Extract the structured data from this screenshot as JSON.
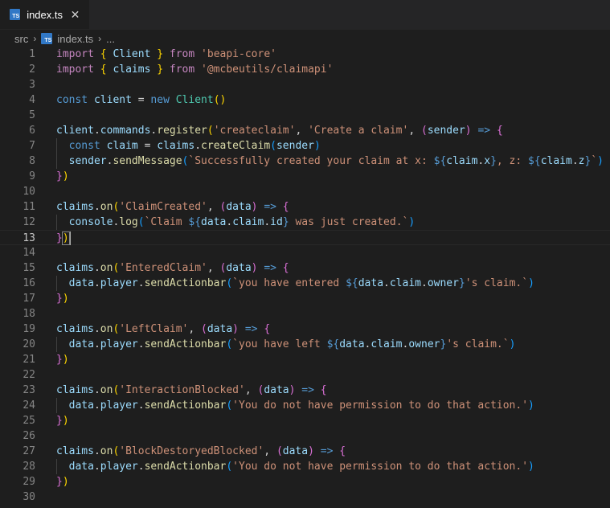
{
  "tab": {
    "icon_label": "TS",
    "title": "index.ts",
    "close_glyph": "✕"
  },
  "breadcrumb": {
    "folder": "src",
    "sep1": "›",
    "file": "index.ts",
    "sep2": "›",
    "more": "..."
  },
  "editor": {
    "current_line": 13,
    "lines": [
      {
        "n": "1",
        "tokens": [
          [
            "kwc",
            "import"
          ],
          [
            "p",
            " "
          ],
          [
            "b1",
            "{"
          ],
          [
            "p",
            " "
          ],
          [
            "var",
            "Client"
          ],
          [
            "p",
            " "
          ],
          [
            "b1",
            "}"
          ],
          [
            "p",
            " "
          ],
          [
            "kwc",
            "from"
          ],
          [
            "p",
            " "
          ],
          [
            "str",
            "'beapi-core'"
          ]
        ]
      },
      {
        "n": "2",
        "tokens": [
          [
            "kwc",
            "import"
          ],
          [
            "p",
            " "
          ],
          [
            "b1",
            "{"
          ],
          [
            "p",
            " "
          ],
          [
            "var",
            "claims"
          ],
          [
            "p",
            " "
          ],
          [
            "b1",
            "}"
          ],
          [
            "p",
            " "
          ],
          [
            "kwc",
            "from"
          ],
          [
            "p",
            " "
          ],
          [
            "str",
            "'@mcbeutils/claimapi'"
          ]
        ]
      },
      {
        "n": "3",
        "tokens": []
      },
      {
        "n": "4",
        "tokens": [
          [
            "kw",
            "const"
          ],
          [
            "p",
            " "
          ],
          [
            "var",
            "client"
          ],
          [
            "p",
            " = "
          ],
          [
            "kw",
            "new"
          ],
          [
            "p",
            " "
          ],
          [
            "cls",
            "Client"
          ],
          [
            "b1",
            "()"
          ]
        ]
      },
      {
        "n": "5",
        "tokens": []
      },
      {
        "n": "6",
        "tokens": [
          [
            "var",
            "client"
          ],
          [
            "p",
            "."
          ],
          [
            "var",
            "commands"
          ],
          [
            "p",
            "."
          ],
          [
            "fn",
            "register"
          ],
          [
            "b1",
            "("
          ],
          [
            "str",
            "'createclaim'"
          ],
          [
            "p",
            ", "
          ],
          [
            "str",
            "'Create a claim'"
          ],
          [
            "p",
            ", "
          ],
          [
            "b2",
            "("
          ],
          [
            "var",
            "sender"
          ],
          [
            "b2",
            ")"
          ],
          [
            "p",
            " "
          ],
          [
            "kw",
            "=>"
          ],
          [
            "p",
            " "
          ],
          [
            "b2",
            "{"
          ]
        ]
      },
      {
        "n": "7",
        "indent": true,
        "tokens": [
          [
            "p",
            "  "
          ],
          [
            "kw",
            "const"
          ],
          [
            "p",
            " "
          ],
          [
            "var",
            "claim"
          ],
          [
            "p",
            " = "
          ],
          [
            "var",
            "claims"
          ],
          [
            "p",
            "."
          ],
          [
            "fn",
            "createClaim"
          ],
          [
            "b3",
            "("
          ],
          [
            "var",
            "sender"
          ],
          [
            "b3",
            ")"
          ]
        ]
      },
      {
        "n": "8",
        "indent": true,
        "tokens": [
          [
            "p",
            "  "
          ],
          [
            "var",
            "sender"
          ],
          [
            "p",
            "."
          ],
          [
            "fn",
            "sendMessage"
          ],
          [
            "b3",
            "("
          ],
          [
            "str",
            "`Successfully created your claim at x: "
          ],
          [
            "int",
            "${"
          ],
          [
            "var",
            "claim"
          ],
          [
            "p",
            "."
          ],
          [
            "var",
            "x"
          ],
          [
            "int",
            "}"
          ],
          [
            "str",
            ", z: "
          ],
          [
            "int",
            "${"
          ],
          [
            "var",
            "claim"
          ],
          [
            "p",
            "."
          ],
          [
            "var",
            "z"
          ],
          [
            "int",
            "}"
          ],
          [
            "str",
            "`"
          ],
          [
            "b3",
            ")"
          ]
        ]
      },
      {
        "n": "9",
        "tokens": [
          [
            "b2",
            "}"
          ],
          [
            "b1",
            ")"
          ]
        ]
      },
      {
        "n": "10",
        "tokens": []
      },
      {
        "n": "11",
        "tokens": [
          [
            "var",
            "claims"
          ],
          [
            "p",
            "."
          ],
          [
            "fn",
            "on"
          ],
          [
            "b1",
            "("
          ],
          [
            "str",
            "'ClaimCreated'"
          ],
          [
            "p",
            ", "
          ],
          [
            "b2",
            "("
          ],
          [
            "var",
            "data"
          ],
          [
            "b2",
            ")"
          ],
          [
            "p",
            " "
          ],
          [
            "kw",
            "=>"
          ],
          [
            "p",
            " "
          ],
          [
            "b2",
            "{"
          ]
        ]
      },
      {
        "n": "12",
        "indent": true,
        "tokens": [
          [
            "p",
            "  "
          ],
          [
            "var",
            "console"
          ],
          [
            "p",
            "."
          ],
          [
            "fn",
            "log"
          ],
          [
            "b3",
            "("
          ],
          [
            "str",
            "`Claim "
          ],
          [
            "int",
            "${"
          ],
          [
            "var",
            "data"
          ],
          [
            "p",
            "."
          ],
          [
            "var",
            "claim"
          ],
          [
            "p",
            "."
          ],
          [
            "var",
            "id"
          ],
          [
            "int",
            "}"
          ],
          [
            "str",
            " was just created.`"
          ],
          [
            "b3",
            ")"
          ]
        ]
      },
      {
        "n": "13",
        "tokens": [
          [
            "b2",
            "}"
          ],
          [
            "b1",
            ")"
          ]
        ]
      },
      {
        "n": "14",
        "tokens": []
      },
      {
        "n": "15",
        "tokens": [
          [
            "var",
            "claims"
          ],
          [
            "p",
            "."
          ],
          [
            "fn",
            "on"
          ],
          [
            "b1",
            "("
          ],
          [
            "str",
            "'EnteredClaim'"
          ],
          [
            "p",
            ", "
          ],
          [
            "b2",
            "("
          ],
          [
            "var",
            "data"
          ],
          [
            "b2",
            ")"
          ],
          [
            "p",
            " "
          ],
          [
            "kw",
            "=>"
          ],
          [
            "p",
            " "
          ],
          [
            "b2",
            "{"
          ]
        ]
      },
      {
        "n": "16",
        "indent": true,
        "tokens": [
          [
            "p",
            "  "
          ],
          [
            "var",
            "data"
          ],
          [
            "p",
            "."
          ],
          [
            "var",
            "player"
          ],
          [
            "p",
            "."
          ],
          [
            "fn",
            "sendActionbar"
          ],
          [
            "b3",
            "("
          ],
          [
            "str",
            "`you have entered "
          ],
          [
            "int",
            "${"
          ],
          [
            "var",
            "data"
          ],
          [
            "p",
            "."
          ],
          [
            "var",
            "claim"
          ],
          [
            "p",
            "."
          ],
          [
            "var",
            "owner"
          ],
          [
            "int",
            "}"
          ],
          [
            "str",
            "'s claim.`"
          ],
          [
            "b3",
            ")"
          ]
        ]
      },
      {
        "n": "17",
        "tokens": [
          [
            "b2",
            "}"
          ],
          [
            "b1",
            ")"
          ]
        ]
      },
      {
        "n": "18",
        "tokens": []
      },
      {
        "n": "19",
        "tokens": [
          [
            "var",
            "claims"
          ],
          [
            "p",
            "."
          ],
          [
            "fn",
            "on"
          ],
          [
            "b1",
            "("
          ],
          [
            "str",
            "'LeftClaim'"
          ],
          [
            "p",
            ", "
          ],
          [
            "b2",
            "("
          ],
          [
            "var",
            "data"
          ],
          [
            "b2",
            ")"
          ],
          [
            "p",
            " "
          ],
          [
            "kw",
            "=>"
          ],
          [
            "p",
            " "
          ],
          [
            "b2",
            "{"
          ]
        ]
      },
      {
        "n": "20",
        "indent": true,
        "tokens": [
          [
            "p",
            "  "
          ],
          [
            "var",
            "data"
          ],
          [
            "p",
            "."
          ],
          [
            "var",
            "player"
          ],
          [
            "p",
            "."
          ],
          [
            "fn",
            "sendActionbar"
          ],
          [
            "b3",
            "("
          ],
          [
            "str",
            "`you have left "
          ],
          [
            "int",
            "${"
          ],
          [
            "var",
            "data"
          ],
          [
            "p",
            "."
          ],
          [
            "var",
            "claim"
          ],
          [
            "p",
            "."
          ],
          [
            "var",
            "owner"
          ],
          [
            "int",
            "}"
          ],
          [
            "str",
            "'s claim.`"
          ],
          [
            "b3",
            ")"
          ]
        ]
      },
      {
        "n": "21",
        "tokens": [
          [
            "b2",
            "}"
          ],
          [
            "b1",
            ")"
          ]
        ]
      },
      {
        "n": "22",
        "tokens": []
      },
      {
        "n": "23",
        "tokens": [
          [
            "var",
            "claims"
          ],
          [
            "p",
            "."
          ],
          [
            "fn",
            "on"
          ],
          [
            "b1",
            "("
          ],
          [
            "str",
            "'InteractionBlocked'"
          ],
          [
            "p",
            ", "
          ],
          [
            "b2",
            "("
          ],
          [
            "var",
            "data"
          ],
          [
            "b2",
            ")"
          ],
          [
            "p",
            " "
          ],
          [
            "kw",
            "=>"
          ],
          [
            "p",
            " "
          ],
          [
            "b2",
            "{"
          ]
        ]
      },
      {
        "n": "24",
        "indent": true,
        "tokens": [
          [
            "p",
            "  "
          ],
          [
            "var",
            "data"
          ],
          [
            "p",
            "."
          ],
          [
            "var",
            "player"
          ],
          [
            "p",
            "."
          ],
          [
            "fn",
            "sendActionbar"
          ],
          [
            "b3",
            "("
          ],
          [
            "str",
            "'You do not have permission to do that action.'"
          ],
          [
            "b3",
            ")"
          ]
        ]
      },
      {
        "n": "25",
        "tokens": [
          [
            "b2",
            "}"
          ],
          [
            "b1",
            ")"
          ]
        ]
      },
      {
        "n": "26",
        "tokens": []
      },
      {
        "n": "27",
        "tokens": [
          [
            "var",
            "claims"
          ],
          [
            "p",
            "."
          ],
          [
            "fn",
            "on"
          ],
          [
            "b1",
            "("
          ],
          [
            "str",
            "'BlockDestoryedBlocked'"
          ],
          [
            "p",
            ", "
          ],
          [
            "b2",
            "("
          ],
          [
            "var",
            "data"
          ],
          [
            "b2",
            ")"
          ],
          [
            "p",
            " "
          ],
          [
            "kw",
            "=>"
          ],
          [
            "p",
            " "
          ],
          [
            "b2",
            "{"
          ]
        ]
      },
      {
        "n": "28",
        "indent": true,
        "tokens": [
          [
            "p",
            "  "
          ],
          [
            "var",
            "data"
          ],
          [
            "p",
            "."
          ],
          [
            "var",
            "player"
          ],
          [
            "p",
            "."
          ],
          [
            "fn",
            "sendActionbar"
          ],
          [
            "b3",
            "("
          ],
          [
            "str",
            "'You do not have permission to do that action.'"
          ],
          [
            "b3",
            ")"
          ]
        ]
      },
      {
        "n": "29",
        "tokens": [
          [
            "b2",
            "}"
          ],
          [
            "b1",
            ")"
          ]
        ]
      },
      {
        "n": "30",
        "tokens": []
      }
    ]
  }
}
